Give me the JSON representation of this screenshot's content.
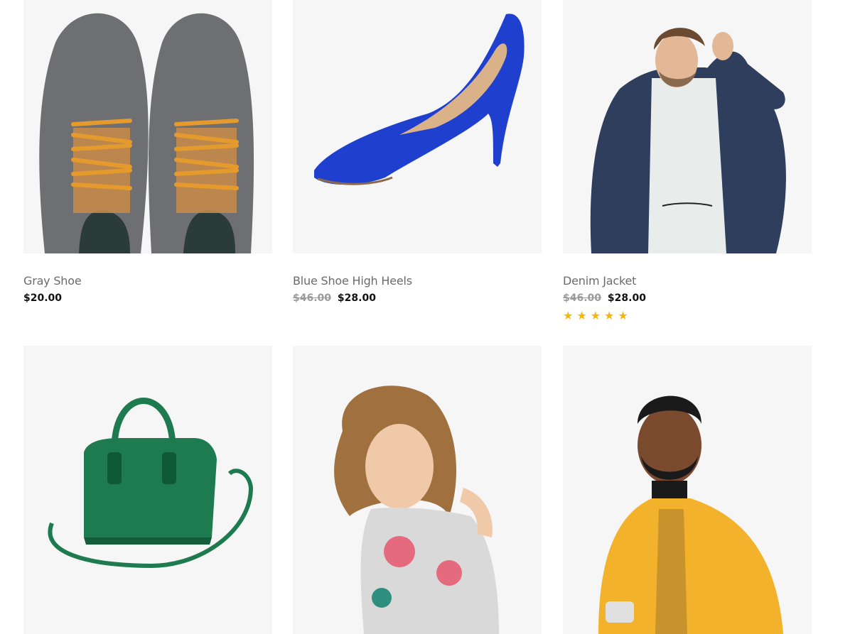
{
  "colors": {
    "accent_star": "#f5b70b",
    "image_bg": "#f6f6f7",
    "title": "#6b6b6b",
    "price": "#111111"
  },
  "products": [
    {
      "title": "Gray Shoe",
      "price": "$20.00",
      "old_price": null,
      "rating": null,
      "image": "gray-shoes-image"
    },
    {
      "title": "Blue Shoe High Heels",
      "price": "$28.00",
      "old_price": "$46.00",
      "rating": null,
      "image": "blue-high-heel-image"
    },
    {
      "title": "Denim Jacket",
      "price": "$28.00",
      "old_price": "$46.00",
      "rating": 5,
      "image": "denim-jacket-man-image"
    },
    {
      "image": "green-handbag-image"
    },
    {
      "image": "woman-floral-top-image"
    },
    {
      "image": "man-yellow-jacket-image"
    }
  ]
}
